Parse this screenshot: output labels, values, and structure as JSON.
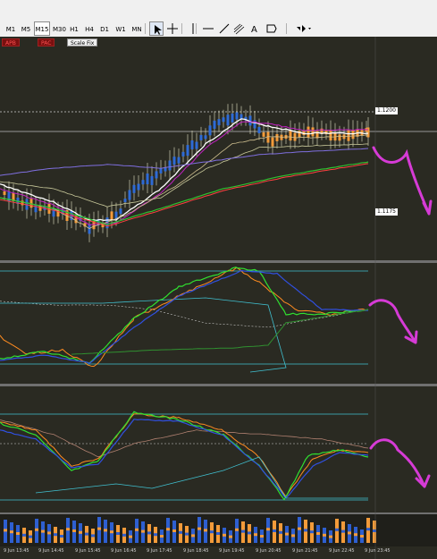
{
  "timeframes": [
    "M1",
    "M5",
    "M15",
    "M30",
    "H1",
    "H4",
    "D1",
    "W1",
    "MN"
  ],
  "active_timeframe": "M15",
  "tools": [
    "cursor-icon",
    "crosshair-icon",
    "vertical-line-icon",
    "horizontal-line-icon",
    "trendline-icon",
    "fibonacci-channel-icon",
    "text-icon",
    "text-label-icon",
    "shapes-dropdown-icon"
  ],
  "indicator_buttons": {
    "apb": "APB",
    "pac": "PAC",
    "scale_fix": "Scale Fix"
  },
  "price_labels": {
    "upper": "1.1200",
    "lower": "1.1175"
  },
  "time_labels": [
    "9 Jun 13:45",
    "9 Jun 14:45",
    "9 Jun 15:45",
    "9 Jun 16:45",
    "9 Jun 17:45",
    "9 Jun 18:45",
    "9 Jun 19:45",
    "9 Jun 20:45",
    "9 Jun 21:45",
    "9 Jun 22:45",
    "9 Jun 23:45"
  ],
  "colors": {
    "background": "#2a2a22",
    "candle_bull": "#2e6bd6",
    "candle_bear": "#f39b3a",
    "annotation": "#d63bd6"
  }
}
